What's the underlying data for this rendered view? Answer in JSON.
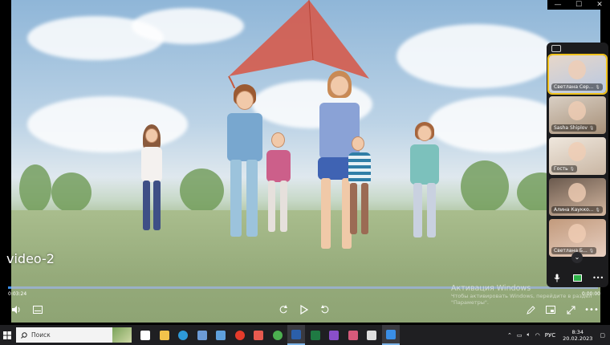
{
  "window": {
    "minimize_label": "—",
    "maximize_label": "☐",
    "close_label": "✕"
  },
  "video": {
    "title": "video-2",
    "time_elapsed": "0:03:24",
    "time_total": "0:00:00",
    "progress": 0.005
  },
  "activation": {
    "title": "Активация Windows",
    "line1": "Чтобы активировать Windows, перейдите в раздел",
    "line2": "\"Параметры\"."
  },
  "participants": [
    {
      "name": "Светлана Сер...",
      "speaking": true,
      "colors": [
        "#e7d7c9",
        "#b8c8e2"
      ]
    },
    {
      "name": "Sasha Shiplov",
      "speaking": false,
      "colors": [
        "#d9cfc4",
        "#a79078"
      ]
    },
    {
      "name": "Гость",
      "speaking": false,
      "colors": [
        "#efe7dd",
        "#c9b6a3"
      ]
    },
    {
      "name": "Алина Каукко...",
      "speaking": false,
      "colors": [
        "#6b5a4e",
        "#d4b7a0"
      ]
    },
    {
      "name": "Светлана Б...",
      "speaking": false,
      "colors": [
        "#c29a7c",
        "#e7cfc1"
      ]
    }
  ],
  "taskbar": {
    "search_placeholder": "Поиск",
    "lang": "РУС",
    "time": "8:34",
    "date": "20.02.2023",
    "apps": [
      {
        "icon": "task-view-icon",
        "color": "#ffffff",
        "active": false
      },
      {
        "icon": "file-explorer-icon",
        "color": "#f2c34b",
        "active": false
      },
      {
        "icon": "edge-icon",
        "color": "#2e9ad8",
        "active": false
      },
      {
        "icon": "store-icon",
        "color": "#6c9bd6",
        "active": false
      },
      {
        "icon": "mail-icon",
        "color": "#5fa0dc",
        "active": false
      },
      {
        "icon": "yandex-browser-icon",
        "color": "#e43b2b",
        "active": false
      },
      {
        "icon": "yandex-icon",
        "color": "#e85a4f",
        "active": false
      },
      {
        "icon": "chrome-icon",
        "color": "#4caf50",
        "active": false
      },
      {
        "icon": "word-icon",
        "color": "#2b5faa",
        "active": true
      },
      {
        "icon": "excel-icon",
        "color": "#1f7a43",
        "active": false
      },
      {
        "icon": "viber-icon",
        "color": "#8a4fc9",
        "active": false
      },
      {
        "icon": "photos-icon",
        "color": "#d65a7b",
        "active": false
      },
      {
        "icon": "camera-icon",
        "color": "#dddddd",
        "active": false
      },
      {
        "icon": "media-player-icon",
        "color": "#3a8ee6",
        "active": true
      }
    ]
  }
}
